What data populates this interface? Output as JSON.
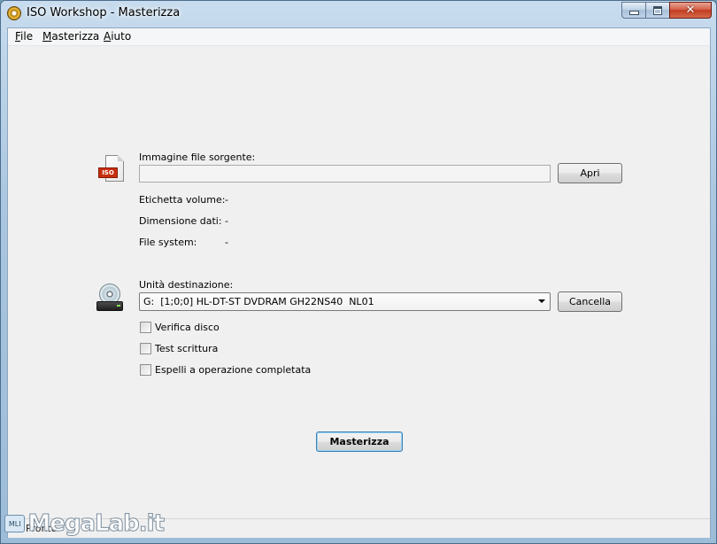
{
  "window": {
    "title": "ISO Workshop - Masterizza"
  },
  "menu": [
    {
      "label": "File",
      "u": "F",
      "rest": "ile"
    },
    {
      "label": "Masterizza",
      "u": "M",
      "rest": "asterizza"
    },
    {
      "label": "Aiuto",
      "u": "A",
      "rest": "iuto"
    }
  ],
  "source": {
    "label": "Immagine file sorgente:",
    "value": "",
    "open_button": "Apri",
    "icon_text": "ISO"
  },
  "info": {
    "volume_label": "Etichetta volume:",
    "volume_value": "-",
    "size_label": "Dimensione dati:",
    "size_value": "-",
    "fs_label": "File system:",
    "fs_value": "-"
  },
  "destination": {
    "label": "Unità destinazione:",
    "selected": "G:  [1;0;0] HL-DT-ST DVDRAM GH22NS40  NL01",
    "erase_button": "Cancella"
  },
  "options": [
    {
      "label": "Verifica disco",
      "checked": false
    },
    {
      "label": "Test scrittura",
      "checked": false
    },
    {
      "label": "Espelli a operazione completata",
      "checked": false
    }
  ],
  "burn_button": "Masterizza",
  "status": "Pronto",
  "watermark": {
    "badge": "MLI",
    "text": "MegaLab.it"
  }
}
